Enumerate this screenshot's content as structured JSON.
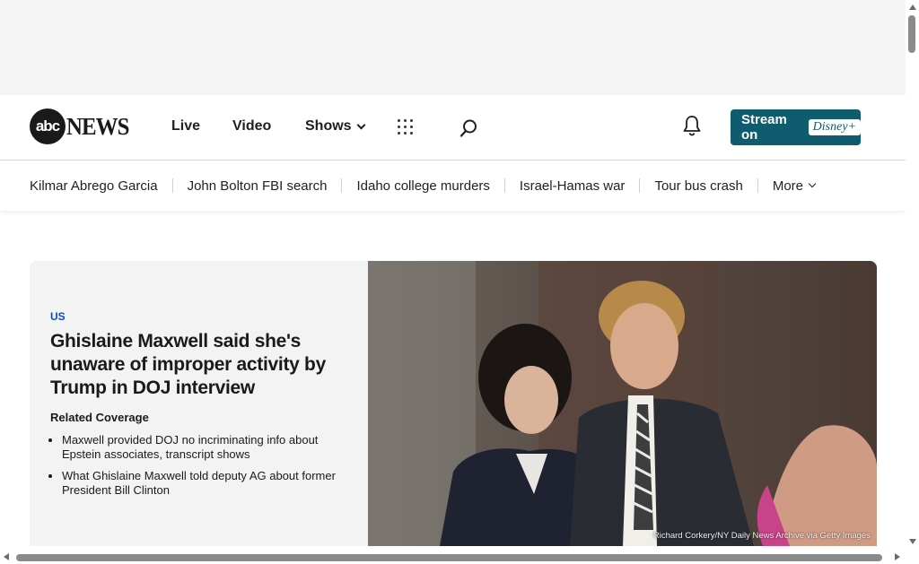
{
  "header": {
    "logo": {
      "circle_text": "abc",
      "word_text": "NEWS"
    },
    "nav": [
      {
        "label": "Live"
      },
      {
        "label": "Video"
      },
      {
        "label": "Shows"
      }
    ],
    "stream_button": {
      "label": "Stream on",
      "brand": "Disney+"
    },
    "colors": {
      "stream_button_bg": "#0f5c6e"
    }
  },
  "trending": {
    "items": [
      {
        "label": "Kilmar Abrego Garcia"
      },
      {
        "label": "John Bolton FBI search"
      },
      {
        "label": "Idaho college murders"
      },
      {
        "label": "Israel-Hamas war"
      },
      {
        "label": "Tour bus crash"
      }
    ],
    "more_label": "More"
  },
  "hero": {
    "section": "US",
    "headline": "Ghislaine Maxwell said she's unaware of improper activity by Trump in DOJ interview",
    "related_title": "Related Coverage",
    "related": [
      {
        "text": "Maxwell provided DOJ no incriminating info about Epstein associates, transcript shows"
      },
      {
        "text": "What Ghislaine Maxwell told deputy AG about former President Bill Clinton"
      }
    ],
    "photo_credit": "Richard Corkery/NY Daily News Archive via Getty Images"
  },
  "icons": [
    "grid-icon",
    "search-icon",
    "bell-icon",
    "chevron-down-icon"
  ]
}
